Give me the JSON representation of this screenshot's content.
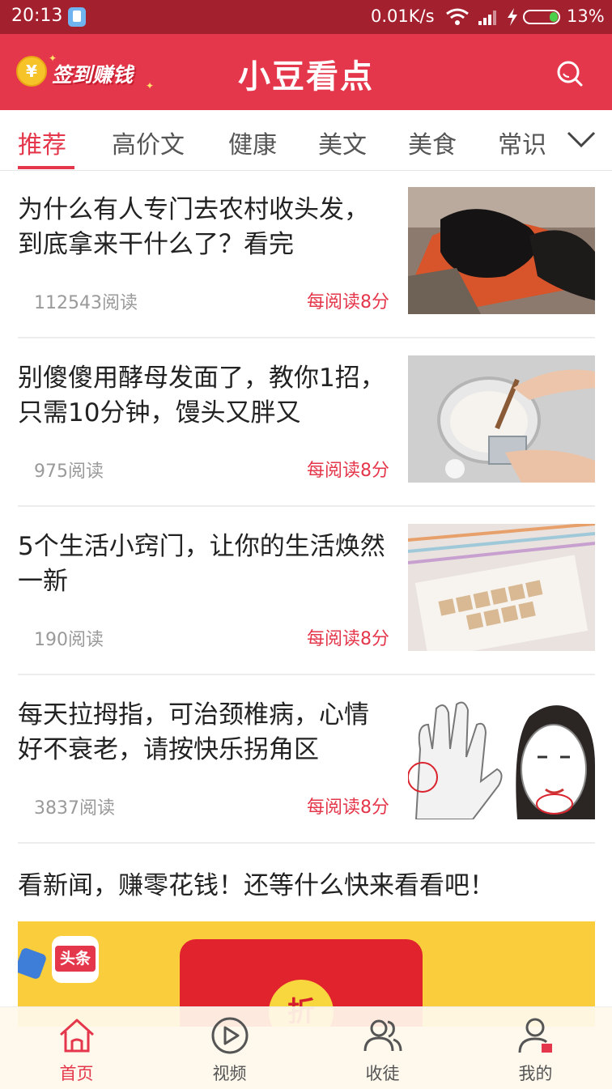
{
  "status_bar": {
    "time": "20:13",
    "speed": "0.01K/s",
    "battery": "13%"
  },
  "header": {
    "signin_label": "签到赚钱",
    "coin_symbol": "¥",
    "logo": "小豆看点",
    "accent_color": "#e5374b"
  },
  "tabs": {
    "items": [
      {
        "label": "推荐",
        "active": true
      },
      {
        "label": "高价文",
        "active": false
      },
      {
        "label": "健康",
        "active": false
      },
      {
        "label": "美文",
        "active": false
      },
      {
        "label": "美食",
        "active": false
      },
      {
        "label": "常识",
        "active": false
      }
    ]
  },
  "feed": {
    "items": [
      {
        "title": "为什么有人专门去农村收头发，到底拿来干什么了？看完",
        "reads": "112543阅读",
        "reward": "每阅读8分"
      },
      {
        "title": "别傻傻用酵母发面了，教你1招，只需10分钟，馒头又胖又",
        "reads": "975阅读",
        "reward": "每阅读8分"
      },
      {
        "title": "5个生活小窍门，让你的生活焕然一新",
        "reads": "190阅读",
        "reward": "每阅读8分"
      },
      {
        "title": "每天拉拇指，可治颈椎病，心情好不衰老，请按快乐拐角区",
        "reads": "3837阅读",
        "reward": "每阅读8分"
      }
    ],
    "ad": {
      "title": "看新闻，赚零花钱！还等什么快来看看吧！",
      "app_label": "头条",
      "seal_char": "折"
    }
  },
  "bottom_nav": {
    "items": [
      {
        "label": "首页",
        "icon": "home-icon",
        "active": true
      },
      {
        "label": "视频",
        "icon": "video-icon",
        "active": false
      },
      {
        "label": "收徒",
        "icon": "apprentice-icon",
        "active": false
      },
      {
        "label": "我的",
        "icon": "profile-icon",
        "active": false
      }
    ]
  }
}
